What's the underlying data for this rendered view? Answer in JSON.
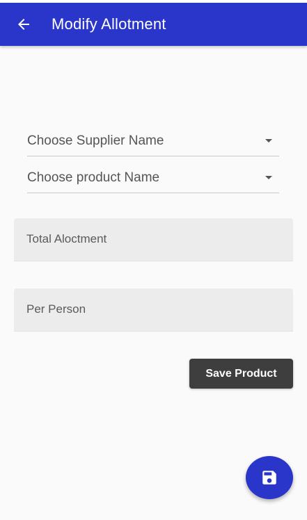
{
  "app_bar": {
    "title": "Modify Allotment",
    "back_icon": "arrow-left-icon",
    "color": "#2a35c9"
  },
  "form": {
    "supplier_dropdown": {
      "label": "Choose Supplier Name",
      "icon": "arrow-drop-down-icon"
    },
    "product_dropdown": {
      "label": "Choose product Name",
      "icon": "arrow-drop-down-icon"
    },
    "total_allotment": {
      "placeholder": "Total Aloctment"
    },
    "per_person": {
      "placeholder": "Per Person"
    },
    "save_button_label": "Save Product"
  },
  "fab": {
    "icon": "save-icon",
    "color": "#2a35c9"
  }
}
